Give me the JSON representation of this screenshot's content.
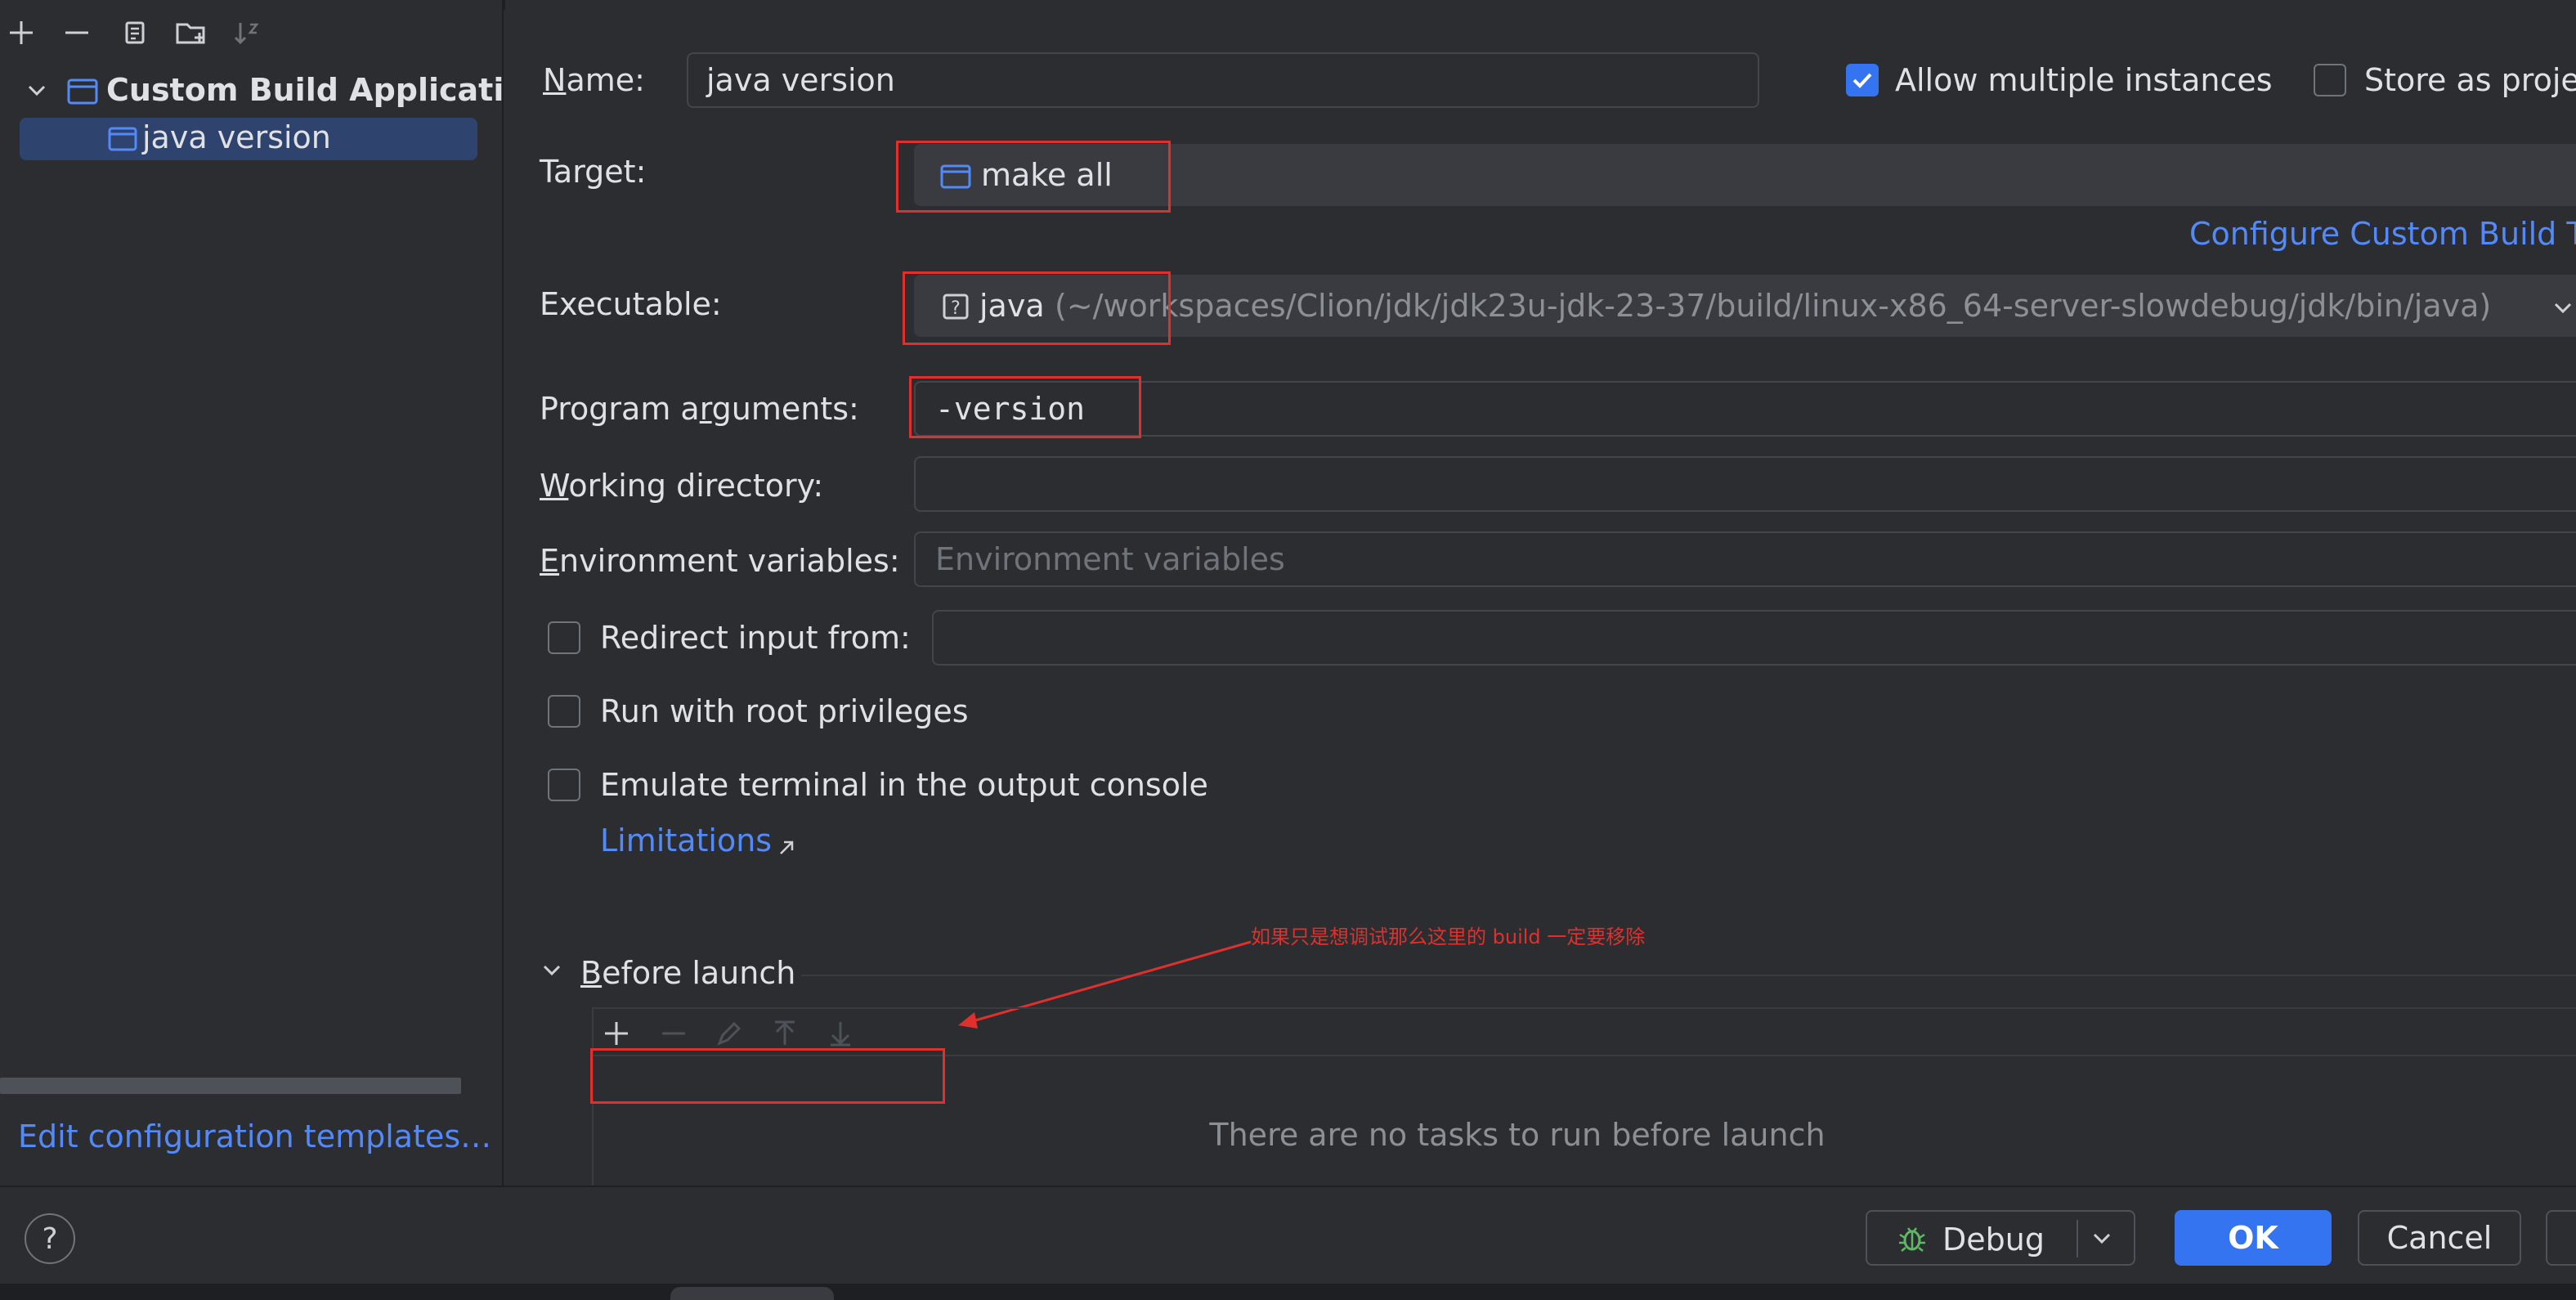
{
  "toolbar": {
    "icons": [
      "plus-icon",
      "minus-icon",
      "copy-icon",
      "new-folder-icon",
      "sort-icon"
    ]
  },
  "tree": {
    "group_label": "Custom Build Application",
    "item_label": "java version"
  },
  "left_footer": {
    "templates_link": "Edit configuration templates…"
  },
  "form": {
    "name_label": "Name:",
    "name_value": "java version",
    "allow_multiple_label": "Allow multiple instances",
    "allow_multiple_checked": true,
    "store_as_project_label": "Store as project file",
    "target_label": "Target:",
    "target_value": "make all",
    "configure_link": "Configure Custom Build Targets",
    "executable_label": "Executable:",
    "executable_name": "java",
    "executable_path": "(~/workspaces/Clion/jdk/jdk23u-jdk-23-37/build/linux-x86_64-server-slowdebug/jdk/bin/java)",
    "program_args_label": "Program arguments:",
    "program_args_value": "-version",
    "working_dir_label": "Working directory:",
    "working_dir_value": "",
    "env_vars_label": "Environment variables:",
    "env_vars_placeholder": "Environment variables",
    "redirect_label": "Redirect input from:",
    "root_label": "Run with root privileges",
    "emulate_label": "Emulate terminal in the output console",
    "limitations_link": "Limitations"
  },
  "before_launch": {
    "title": "Before launch",
    "empty_text": "There are no tasks to run before launch",
    "annotation": "如果只是想调试那么这里的 build 一定要移除",
    "annotation_color": "#e0302d"
  },
  "buttons": {
    "help": "?",
    "debug": "Debug",
    "ok": "OK",
    "cancel": "Cancel"
  },
  "colors": {
    "accent": "#3574f0",
    "link": "#548af7",
    "background": "#2b2d30",
    "selection": "#2e436e",
    "annotation_red": "#e0302d"
  }
}
